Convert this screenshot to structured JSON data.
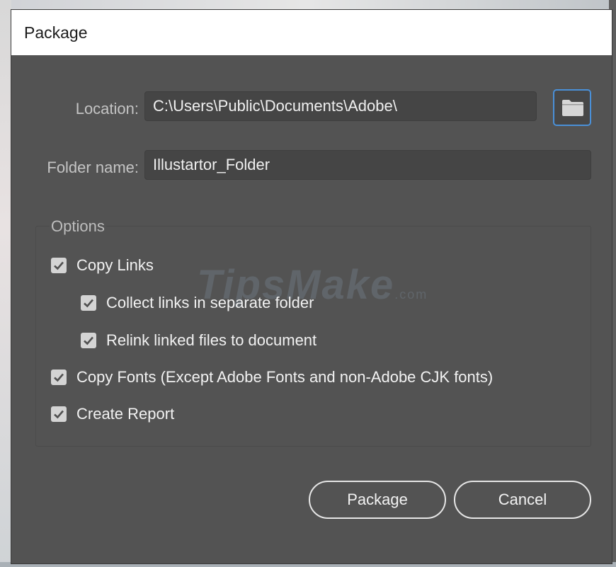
{
  "dialog": {
    "title": "Package"
  },
  "location": {
    "label": "Location:",
    "value": "C:\\Users\\Public\\Documents\\Adobe\\"
  },
  "folder_name": {
    "label": "Folder name:",
    "value": "Illustartor_Folder"
  },
  "options": {
    "title": "Options",
    "items": [
      {
        "label": "Copy Links",
        "checked": true
      },
      {
        "label": "Collect links in separate folder",
        "checked": true
      },
      {
        "label": "Relink linked files to document",
        "checked": true
      },
      {
        "label": "Copy Fonts (Except Adobe Fonts and non-Adobe CJK fonts)",
        "checked": true
      },
      {
        "label": "Create Report",
        "checked": true
      }
    ]
  },
  "watermark": {
    "text": "TipsMake",
    "suffix": ".com"
  },
  "buttons": {
    "package": "Package",
    "cancel": "Cancel"
  },
  "icons": {
    "browse": "folder-icon",
    "check": "checkmark-icon"
  },
  "colors": {
    "dialog_bg": "#535353",
    "field_bg": "#454545",
    "focus_blue": "#4a90d8"
  }
}
